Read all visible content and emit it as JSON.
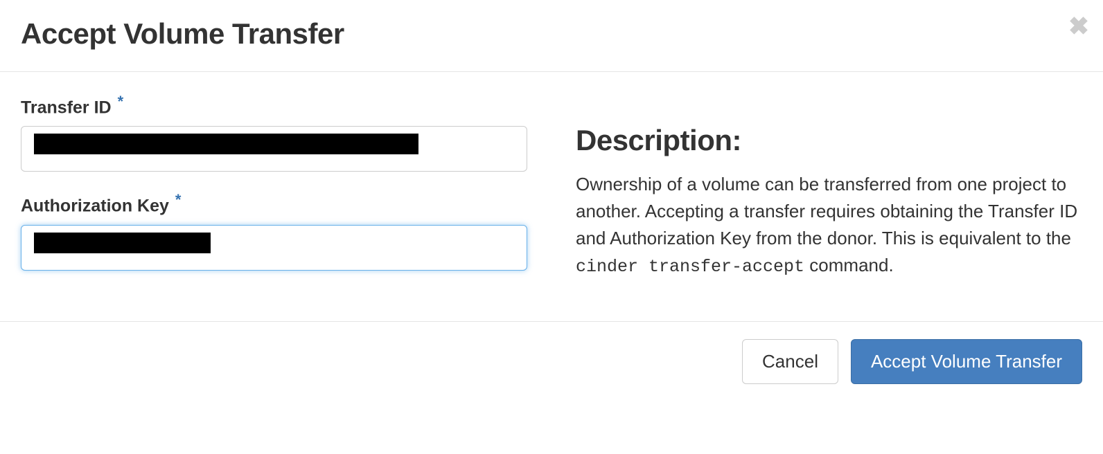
{
  "header": {
    "title": "Accept Volume Transfer"
  },
  "form": {
    "transfer_id": {
      "label": "Transfer ID",
      "required_marker": "*",
      "value_redacted": true
    },
    "authorization_key": {
      "label": "Authorization Key",
      "required_marker": "*",
      "value_redacted": true
    }
  },
  "description": {
    "heading": "Description:",
    "text_before_code": "Ownership of a volume can be transferred from one project to another. Accepting a transfer requires obtaining the Transfer ID and Authorization Key from the donor. This is equivalent to the ",
    "code": "cinder transfer-accept",
    "text_after_code": " command."
  },
  "footer": {
    "cancel_label": "Cancel",
    "accept_label": "Accept Volume Transfer"
  }
}
